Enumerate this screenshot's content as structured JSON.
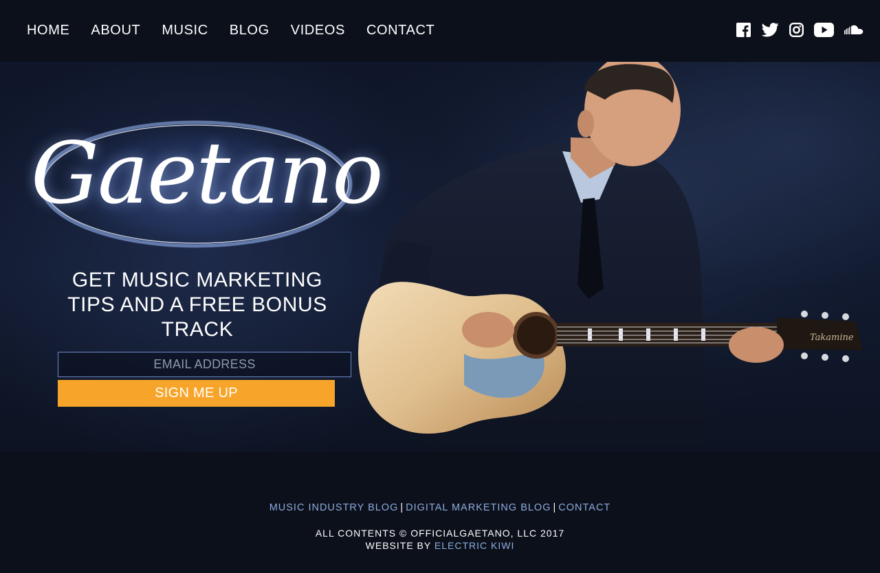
{
  "nav": {
    "items": [
      {
        "label": "HOME"
      },
      {
        "label": "ABOUT"
      },
      {
        "label": "MUSIC"
      },
      {
        "label": "BLOG"
      },
      {
        "label": "VIDEOS"
      },
      {
        "label": "CONTACT"
      }
    ],
    "social_icons": [
      "facebook-icon",
      "twitter-icon",
      "instagram-icon",
      "youtube-icon",
      "soundcloud-icon"
    ]
  },
  "hero": {
    "logo_text": "Gaetano",
    "headline": "GET MUSIC MARKETING TIPS AND A FREE BONUS TRACK",
    "email_placeholder": "EMAIL ADDRESS",
    "email_value": "",
    "signup_label": "SIGN ME UP",
    "guitar_brand": "Takamine"
  },
  "footer": {
    "links": [
      {
        "label": "MUSIC INDUSTRY BLOG"
      },
      {
        "label": "DIGITAL MARKETING BLOG"
      },
      {
        "label": "CONTACT"
      }
    ],
    "separator": "|",
    "copyright": "ALL CONTENTS © OFFICIALGAETANO, LLC 2017",
    "credit_prefix": "WEBSITE BY",
    "credit_link": "ELECTRIC KIWI"
  },
  "colors": {
    "background": "#0c101b",
    "accent_button": "#f7a52a",
    "link": "#8eaddf",
    "input_border": "#6f8ac8"
  }
}
